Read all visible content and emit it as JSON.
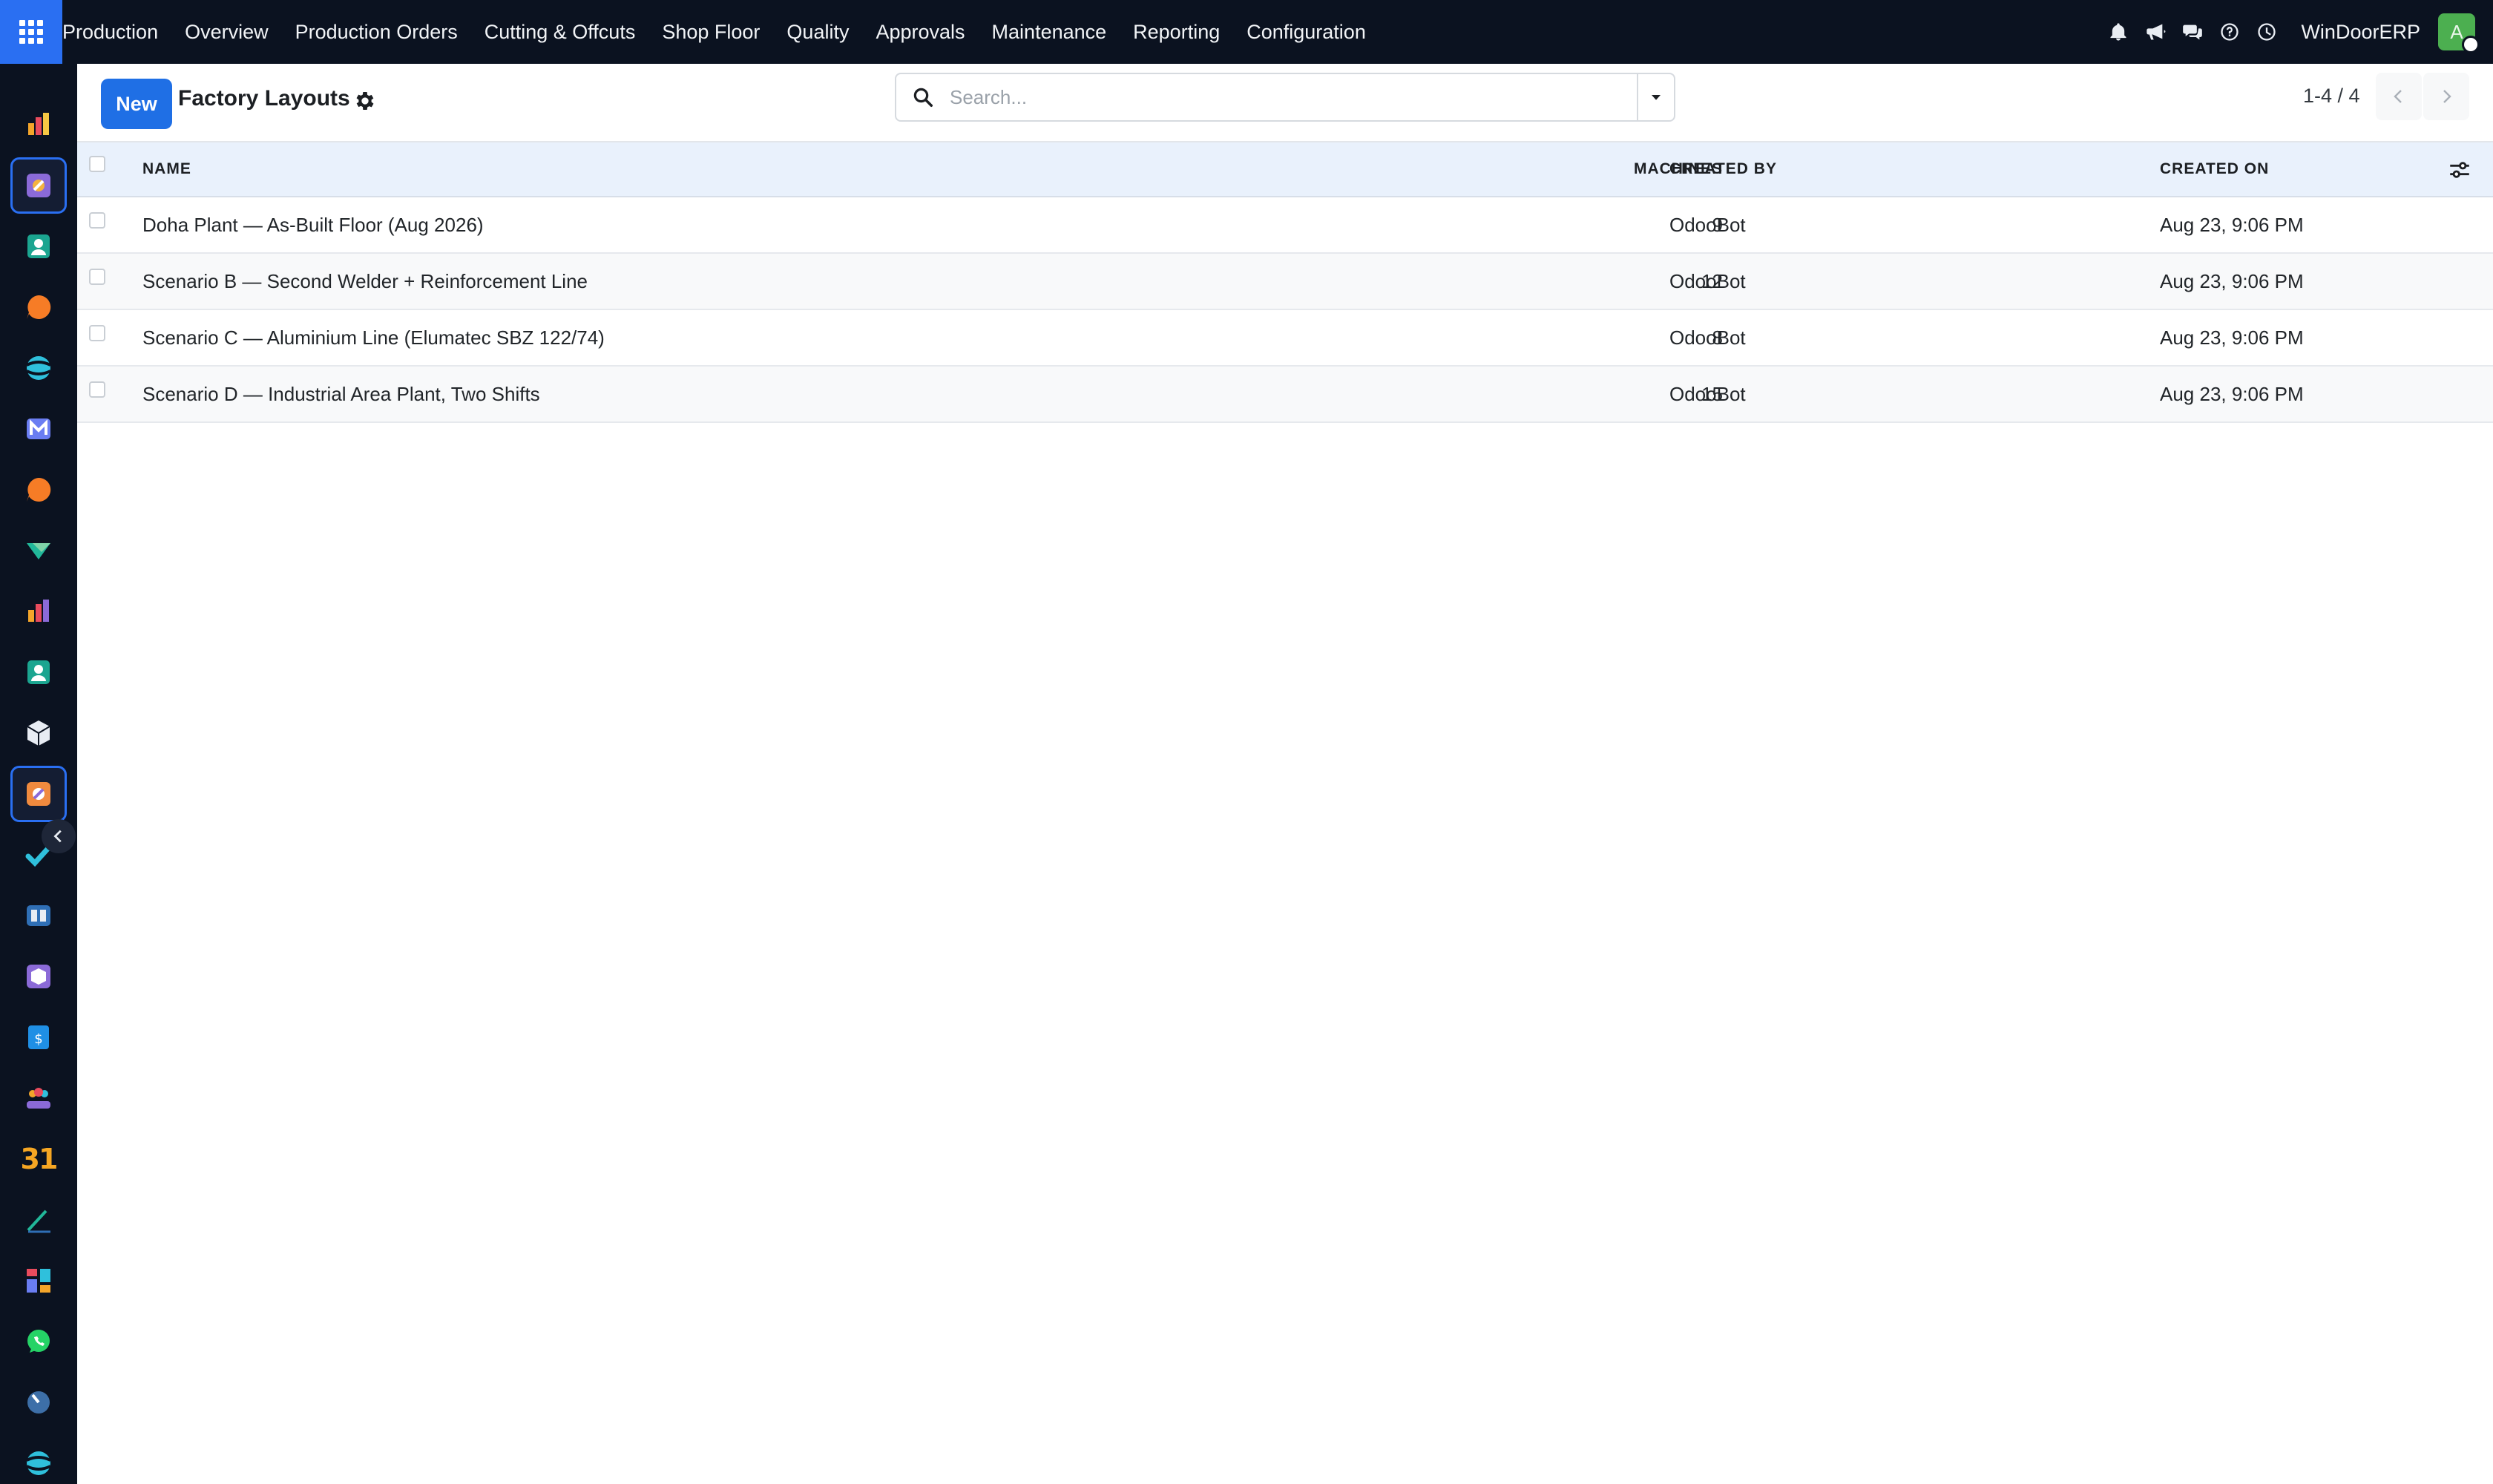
{
  "topbar": {
    "menu": [
      "Production",
      "Overview",
      "Production Orders",
      "Cutting & Offcuts",
      "Shop Floor",
      "Quality",
      "Approvals",
      "Maintenance",
      "Reporting",
      "Configuration"
    ],
    "company": "WinDoorERP",
    "avatar_initial": "A",
    "icons": [
      "bell-icon",
      "megaphone-icon",
      "chat-icon",
      "help-icon",
      "clock-icon"
    ]
  },
  "sidebar": {
    "apps": [
      "bar-chart-icon",
      "manufacturing-icon",
      "contacts-icon",
      "discuss-icon",
      "website-icon",
      "email-marketing-icon",
      "discuss-icon",
      "sign-icon",
      "bar-chart-icon",
      "contacts-icon",
      "cube-icon",
      "manufacturing-icon",
      "checkmark-icon",
      "knowledge-icon",
      "3d-box-icon",
      "invoicing-icon",
      "employees-icon",
      "calendar-icon",
      "signature-icon",
      "dashboards-icon",
      "whatsapp-icon",
      "timer-icon",
      "website-icon"
    ],
    "calendar_label": "31",
    "active_indices": [
      1,
      11
    ]
  },
  "control": {
    "new_label": "New",
    "title": "Factory Layouts",
    "search_placeholder": "Search...",
    "pager": "1-4 / 4"
  },
  "table": {
    "columns": {
      "name": "NAME",
      "machines": "MACHINES",
      "created_by": "CREATED BY",
      "created_on": "CREATED ON"
    },
    "rows": [
      {
        "name": "Doha Plant — As-Built Floor (Aug 2026)",
        "machines": "9",
        "created_by": "OdooBot",
        "created_on": "Aug 23, 9:06 PM"
      },
      {
        "name": "Scenario B — Second Welder + Reinforcement Line",
        "machines": "12",
        "created_by": "OdooBot",
        "created_on": "Aug 23, 9:06 PM"
      },
      {
        "name": "Scenario C — Aluminium Line (Elumatec SBZ 122/74)",
        "machines": "8",
        "created_by": "OdooBot",
        "created_on": "Aug 23, 9:06 PM"
      },
      {
        "name": "Scenario D — Industrial Area Plant, Two Shifts",
        "machines": "15",
        "created_by": "OdooBot",
        "created_on": "Aug 23, 9:06 PM"
      }
    ]
  },
  "colors": {
    "navbar": "#0b1220",
    "accent": "#1f6fe5",
    "header_row": "#e9f1fc"
  }
}
